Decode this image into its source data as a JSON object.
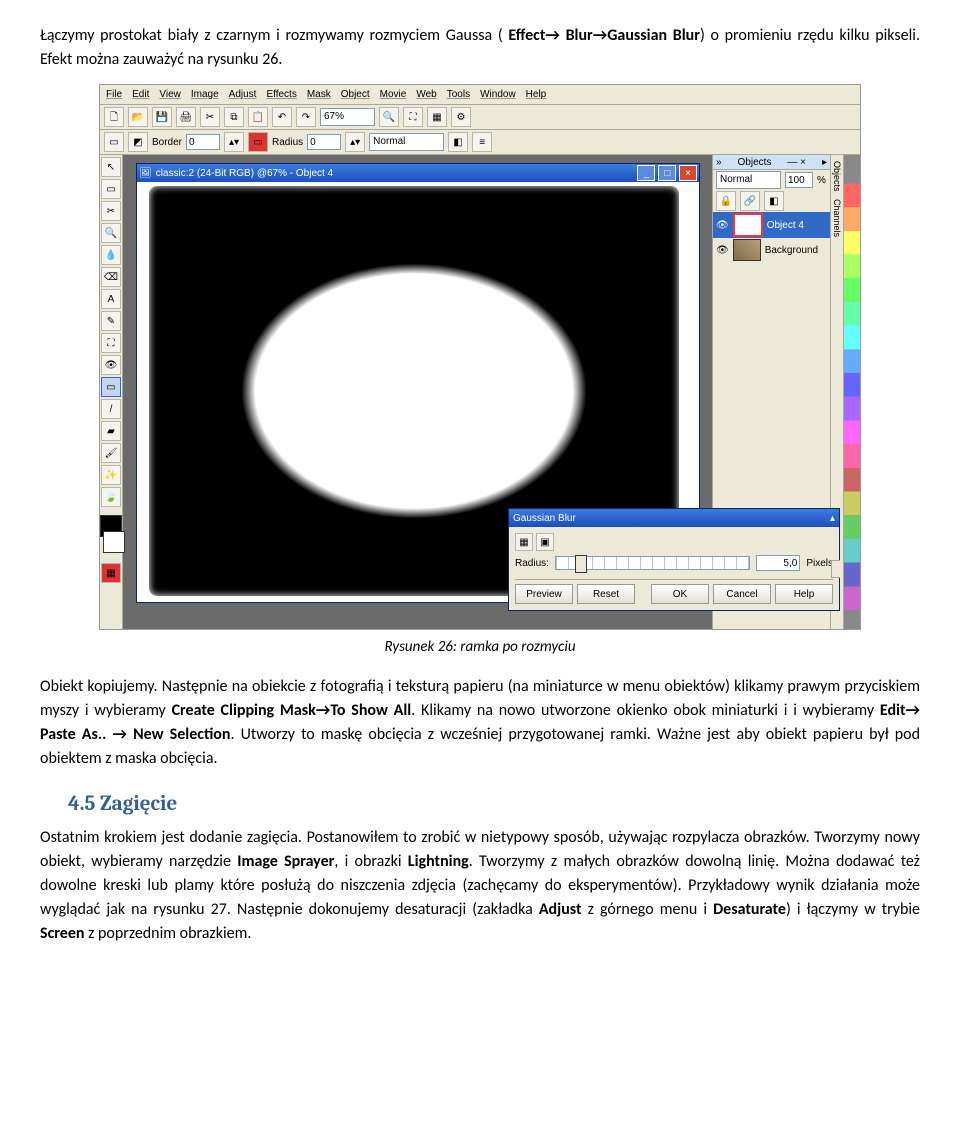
{
  "text": {
    "p1a": "Łączymy prostokat biały z czarnym i rozmywamy rozmyciem Gaussa ( ",
    "p1b": "Effect→ Blur→Gaussian Blur",
    "p1c": ") o promieniu rzędu kilku pikseli. Efekt można zauważyć na rysunku 26.",
    "caption": "Rysunek 26: ramka po rozmyciu",
    "p2a": "Obiekt kopiujemy. Następnie na obiekcie z fotografią i teksturą papieru (na miniaturce w menu obiektów) klikamy prawym przyciskiem myszy i wybieramy ",
    "p2b": "Create Clipping Mask→To Show All",
    "p2c": ". Klikamy na nowo utworzone okienko obok miniaturki i i wybieramy ",
    "p2d": "Edit→ Paste As.. → New Selection",
    "p2e": ". Utworzy to maskę obcięcia z wcześniej przygotowanej ramki. Ważne jest aby obiekt papieru był pod obiektem z maska obcięcia.",
    "h45": "4.5 Zagięcie",
    "p3a": "Ostatnim krokiem jest dodanie zagięcia. Postanowiłem to zrobić w nietypowy sposób, używając rozpylacza obrazków. Tworzymy nowy obiekt, wybieramy narzędzie ",
    "p3b": "Image Sprayer",
    "p3c": ", i obrazki ",
    "p3d": "Lightning",
    "p3e": ". Tworzymy z małych obrazków dowolną linię. Można dodawać też dowolne kreski lub plamy które posłużą do niszczenia zdjęcia (zachęcamy do eksperymentów). Przykładowy wynik działania może wyglądać jak na rysunku 27. Następnie dokonujemy desaturacji (zakładka ",
    "p3f": "Adjust",
    "p3g": " z górnego menu i ",
    "p3h": "Desaturate",
    "p3i": ") i łączymy w trybie ",
    "p3j": "Screen",
    "p3k": " z poprzednim obrazkiem."
  },
  "app": {
    "menus": [
      "File",
      "Edit",
      "View",
      "Image",
      "Adjust",
      "Effects",
      "Mask",
      "Object",
      "Movie",
      "Web",
      "Tools",
      "Window",
      "Help"
    ],
    "zoom": "67%",
    "border_label": "Border",
    "border_value": "0",
    "radius_label": "Radius",
    "radius_value": "0",
    "mode": "Normal",
    "doc_title": "classic:2 (24-Bit RGB) @67% - Object 4",
    "objects_header": "Objects",
    "blend_mode": "Normal",
    "opacity_value": "100",
    "opacity_suffix": "%",
    "layer_obj4": "Object 4",
    "layer_bg": "Background",
    "side_tabs_1": "Objects",
    "side_tabs_2": "Channels"
  },
  "dialog": {
    "title": "Gaussian Blur",
    "radius_label": "Radius:",
    "radius_value": "5,0",
    "radius_unit": "Pixels",
    "btn_preview": "Preview",
    "btn_reset": "Reset",
    "btn_ok": "OK",
    "btn_cancel": "Cancel",
    "btn_help": "Help"
  }
}
